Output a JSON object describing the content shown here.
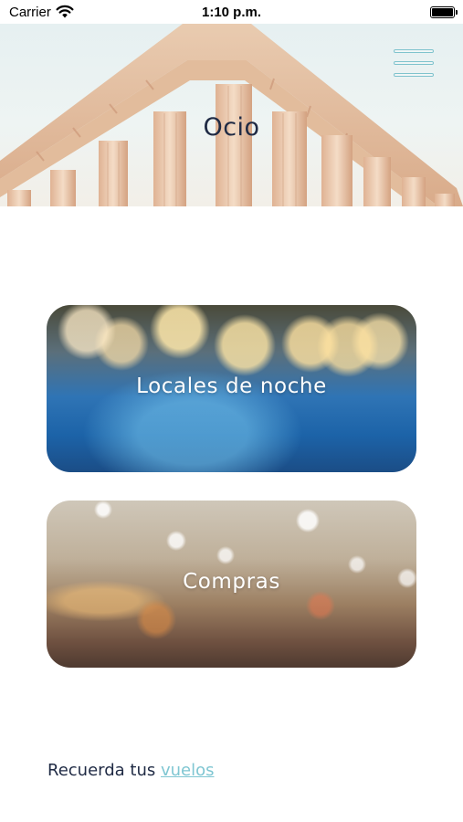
{
  "status_bar": {
    "carrier": "Carrier",
    "time": "1:10 p.m.",
    "icons": [
      "wifi-icon",
      "battery-icon"
    ]
  },
  "header": {
    "title": "Ocio",
    "menu_icon": "hamburger-menu-icon",
    "accent_color": "#7fc3cd"
  },
  "cards": [
    {
      "label": "Locales de noche"
    },
    {
      "label": "Compras"
    }
  ],
  "footer": {
    "text": "Recuerda tus",
    "link": "vuelos",
    "link_color": "#7fc6d2"
  }
}
